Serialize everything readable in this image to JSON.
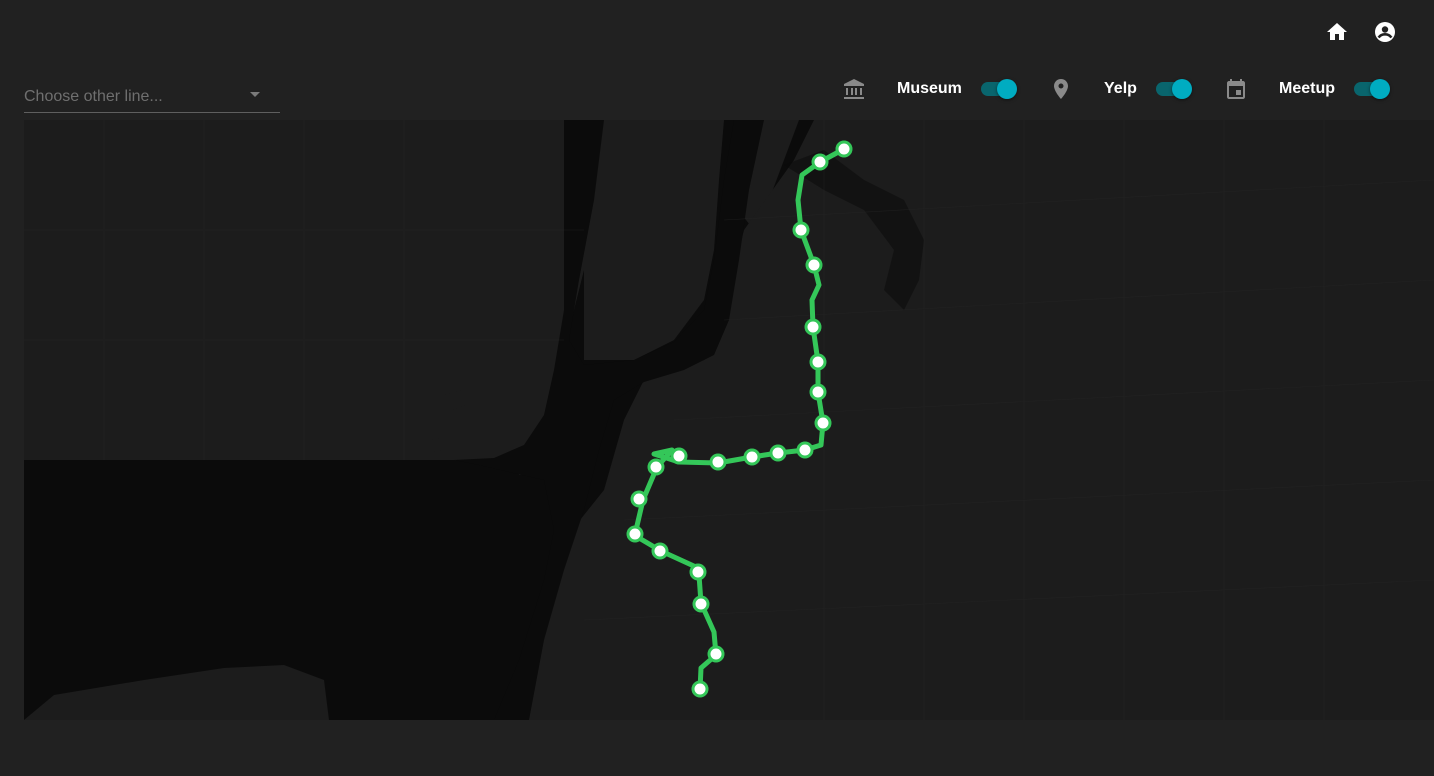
{
  "header": {
    "home_icon": "home-icon",
    "account_icon": "account-circle-icon"
  },
  "line_select": {
    "placeholder": "Choose other line...",
    "selected": ""
  },
  "filters": [
    {
      "icon": "museum-icon",
      "label": "Museum",
      "enabled": true
    },
    {
      "icon": "location-pin-icon",
      "label": "Yelp",
      "enabled": true
    },
    {
      "icon": "calendar-icon",
      "label": "Meetup",
      "enabled": true
    }
  ],
  "map": {
    "route_color": "#34c759",
    "station_fill": "#ffffff",
    "station_count": 23
  },
  "colors": {
    "background": "#212121",
    "map_water": "#0b0b0b",
    "map_land": "#1c1c1c",
    "toggle_accent": "#00acc1"
  }
}
